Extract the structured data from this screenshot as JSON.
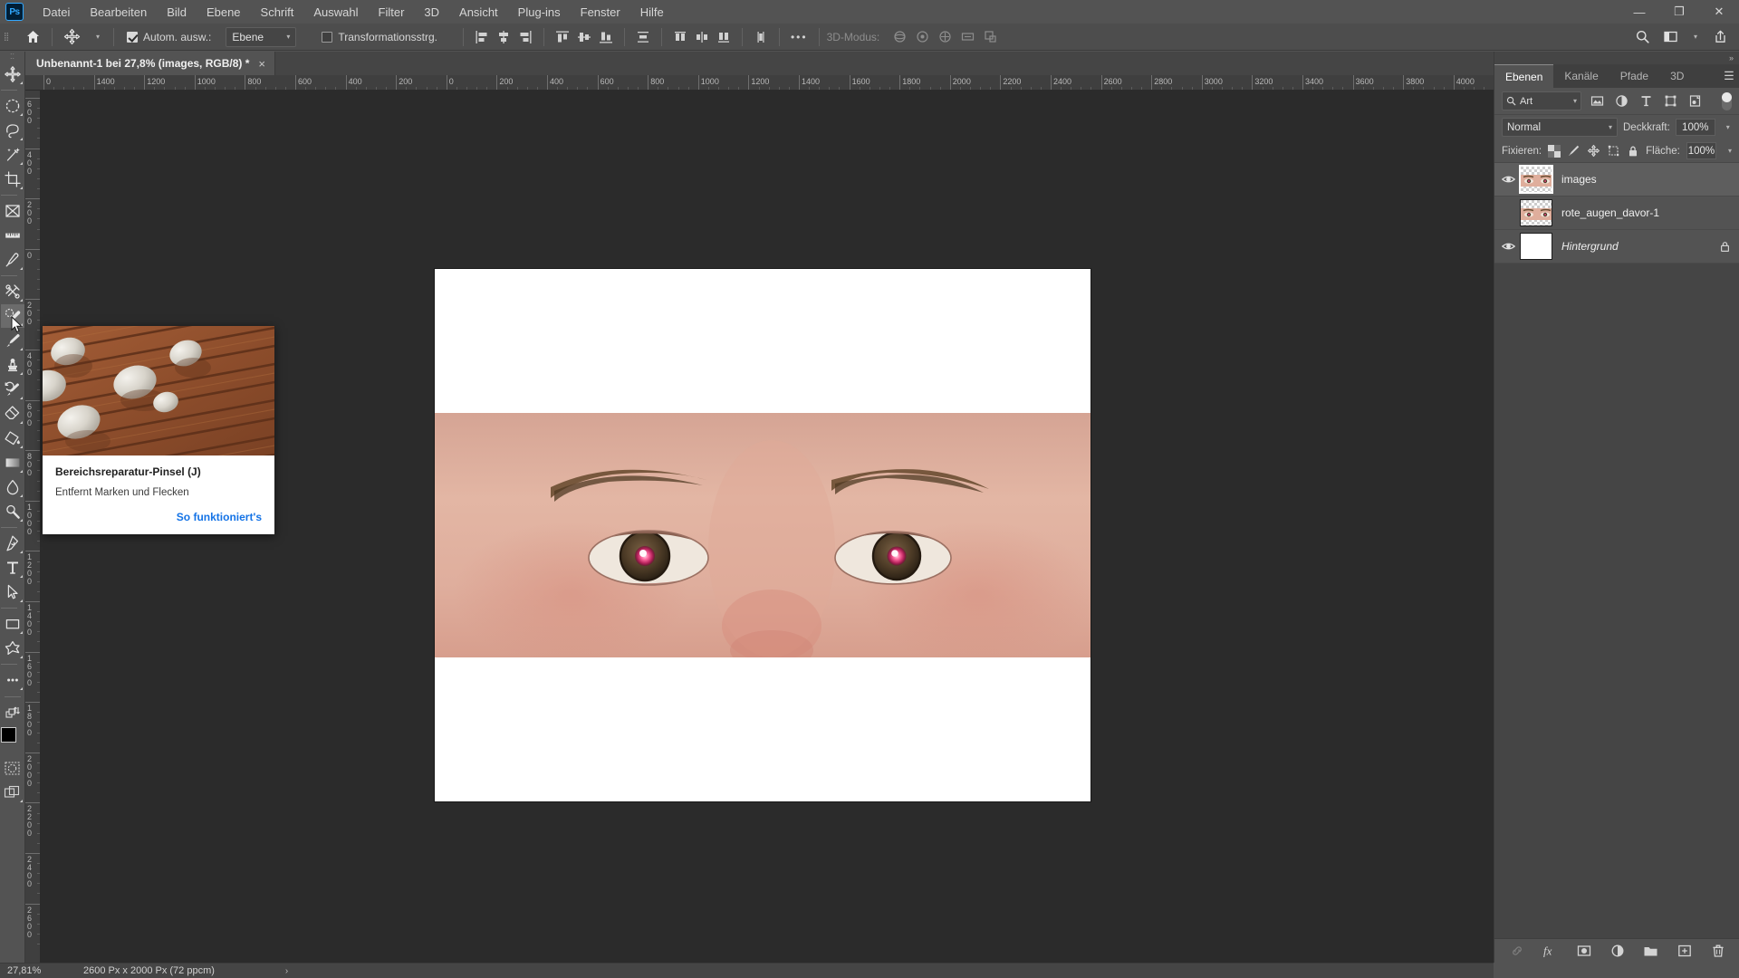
{
  "app": {
    "logo_text": "Ps",
    "menus": [
      "Datei",
      "Bearbeiten",
      "Bild",
      "Ebene",
      "Schrift",
      "Auswahl",
      "Filter",
      "3D",
      "Ansicht",
      "Plug-ins",
      "Fenster",
      "Hilfe"
    ],
    "window_controls": {
      "minimize": "—",
      "restore": "❐",
      "close": "✕"
    }
  },
  "options_bar": {
    "home_label": "Startbildschirm",
    "tool_icon": "move-tool",
    "auto_select_label": "Autom. ausw.:",
    "auto_select_checked": true,
    "auto_select_target": "Ebene",
    "transform_controls_label": "Transformationsstrg.",
    "transform_controls_checked": false,
    "more_label": "•••",
    "three_d_mode_label": "3D-Modus:",
    "search_icon": "search-icon",
    "workspace_icon": "workspace-icon",
    "share_icon": "share-icon"
  },
  "document": {
    "tab_title": "Unbenannt-1 bei 27,8% (images, RGB/8) *",
    "close_glyph": "×"
  },
  "rulers": {
    "horizontal_labels": [
      "0",
      "1400",
      "1200",
      "1000",
      "800",
      "600",
      "400",
      "200",
      "0",
      "200",
      "400",
      "600",
      "800",
      "1000",
      "1200",
      "1400",
      "1600",
      "1800",
      "2000",
      "2200",
      "2400",
      "2600",
      "2800",
      "3000",
      "3200",
      "3400",
      "3600",
      "3800",
      "4000"
    ],
    "vertical_labels": [
      "600",
      "400",
      "200",
      "0",
      "200",
      "400",
      "600",
      "800",
      "1000",
      "1200",
      "1400",
      "1600",
      "1800",
      "2000",
      "2200",
      "2400",
      "2600"
    ]
  },
  "toolbar": {
    "tools": [
      {
        "name": "move-tool",
        "glyph": "move",
        "has_submenu": true,
        "selected": false
      },
      {
        "name": "marquee-tool",
        "glyph": "marquee",
        "has_submenu": true,
        "selected": false
      },
      {
        "name": "lasso-tool",
        "glyph": "lasso",
        "has_submenu": true,
        "selected": false
      },
      {
        "name": "magic-wand-tool",
        "glyph": "wand",
        "has_submenu": true,
        "selected": false
      },
      {
        "name": "crop-tool",
        "glyph": "crop",
        "has_submenu": true,
        "selected": false
      },
      {
        "name": "frame-tool",
        "glyph": "frame",
        "has_submenu": false,
        "selected": false
      },
      {
        "name": "eyedropper-ruler-tool",
        "glyph": "ruler",
        "has_submenu": false,
        "selected": false
      },
      {
        "name": "eyedropper-tool",
        "glyph": "eyedropper",
        "has_submenu": true,
        "selected": false
      },
      {
        "name": "retouch-tool",
        "glyph": "retouch",
        "has_submenu": true,
        "selected": false
      },
      {
        "name": "spot-healing-brush-tool",
        "glyph": "healing",
        "has_submenu": true,
        "selected": true
      },
      {
        "name": "brush-tool",
        "glyph": "brush",
        "has_submenu": true,
        "selected": false
      },
      {
        "name": "clone-stamp-tool",
        "glyph": "stamp",
        "has_submenu": true,
        "selected": false
      },
      {
        "name": "history-brush-tool",
        "glyph": "historybrush",
        "has_submenu": true,
        "selected": false
      },
      {
        "name": "eraser-tool",
        "glyph": "eraser",
        "has_submenu": true,
        "selected": false
      },
      {
        "name": "paint-bucket-tool",
        "glyph": "bucket",
        "has_submenu": true,
        "selected": false
      },
      {
        "name": "gradient-tool",
        "glyph": "gradient",
        "has_submenu": true,
        "selected": false
      },
      {
        "name": "blur-tool",
        "glyph": "blur",
        "has_submenu": true,
        "selected": false
      },
      {
        "name": "dodge-tool",
        "glyph": "dodge",
        "has_submenu": true,
        "selected": false
      },
      {
        "name": "pen-tool",
        "glyph": "pen",
        "has_submenu": true,
        "selected": false
      },
      {
        "name": "type-tool",
        "glyph": "type",
        "has_submenu": true,
        "selected": false
      },
      {
        "name": "path-selection-tool",
        "glyph": "pathselect",
        "has_submenu": true,
        "selected": false
      },
      {
        "name": "rectangle-tool",
        "glyph": "rect",
        "has_submenu": true,
        "selected": false
      },
      {
        "name": "custom-shape-tool",
        "glyph": "shape",
        "has_submenu": true,
        "selected": false
      },
      {
        "name": "more-tools",
        "glyph": "dots",
        "has_submenu": true,
        "selected": false
      }
    ],
    "foreground_color": "#000000",
    "background_color": "#63f52a",
    "quickmask_name": "quick-mask-icon",
    "screenmode_name": "screen-mode-icon"
  },
  "tooltip": {
    "title": "Bereichsreparatur-Pinsel (J)",
    "description": "Entfernt Marken und Flecken",
    "link": "So funktioniert's",
    "image_alt": "wooden-deck-with-stones"
  },
  "panels": {
    "collapse_glyph": "»",
    "tabs": [
      {
        "label": "Ebenen",
        "active": true
      },
      {
        "label": "Kanäle",
        "active": false
      },
      {
        "label": "Pfade",
        "active": false
      },
      {
        "label": "3D",
        "active": false
      }
    ],
    "menu_glyph": "☰",
    "filter": {
      "kind_label": "Art",
      "search_icon": "search-icon",
      "filter_icons": [
        "pixel-filter-icon",
        "adjustment-filter-icon",
        "type-filter-icon",
        "shape-filter-icon",
        "smart-object-filter-icon"
      ],
      "toggle_name": "filter-toggle"
    },
    "blend": {
      "mode": "Normal",
      "opacity_label": "Deckkraft:",
      "opacity_value": "100%"
    },
    "lock": {
      "label": "Fixieren:",
      "icons": [
        "lock-transparency-icon",
        "lock-image-icon",
        "lock-position-icon",
        "lock-artboard-icon",
        "lock-all-icon"
      ],
      "fill_label": "Fläche:",
      "fill_value": "100%"
    },
    "layers": [
      {
        "name": "images",
        "visible": true,
        "selected": true,
        "locked": false,
        "italic": false,
        "thumb": "eyes"
      },
      {
        "name": "rote_augen_davor-1",
        "visible": false,
        "selected": false,
        "locked": false,
        "italic": false,
        "thumb": "eyes"
      },
      {
        "name": "Hintergrund",
        "visible": true,
        "selected": false,
        "locked": true,
        "italic": true,
        "thumb": "white"
      }
    ],
    "footer_icons": [
      "link-layers-icon",
      "layer-style-fx-icon",
      "layer-mask-icon",
      "adjustment-layer-icon",
      "new-group-icon",
      "new-layer-icon",
      "delete-layer-icon"
    ]
  },
  "status_bar": {
    "zoom": "27,81%",
    "doc_info": "2600 Px x 2000 Px (72 ppcm)",
    "expand_glyph": "›"
  },
  "colors": {
    "app_bg": "#535353",
    "panel_bg": "#454545",
    "canvas_bg": "#2b2b2b",
    "accent_link": "#1473e6",
    "tab_active": "#535353"
  }
}
